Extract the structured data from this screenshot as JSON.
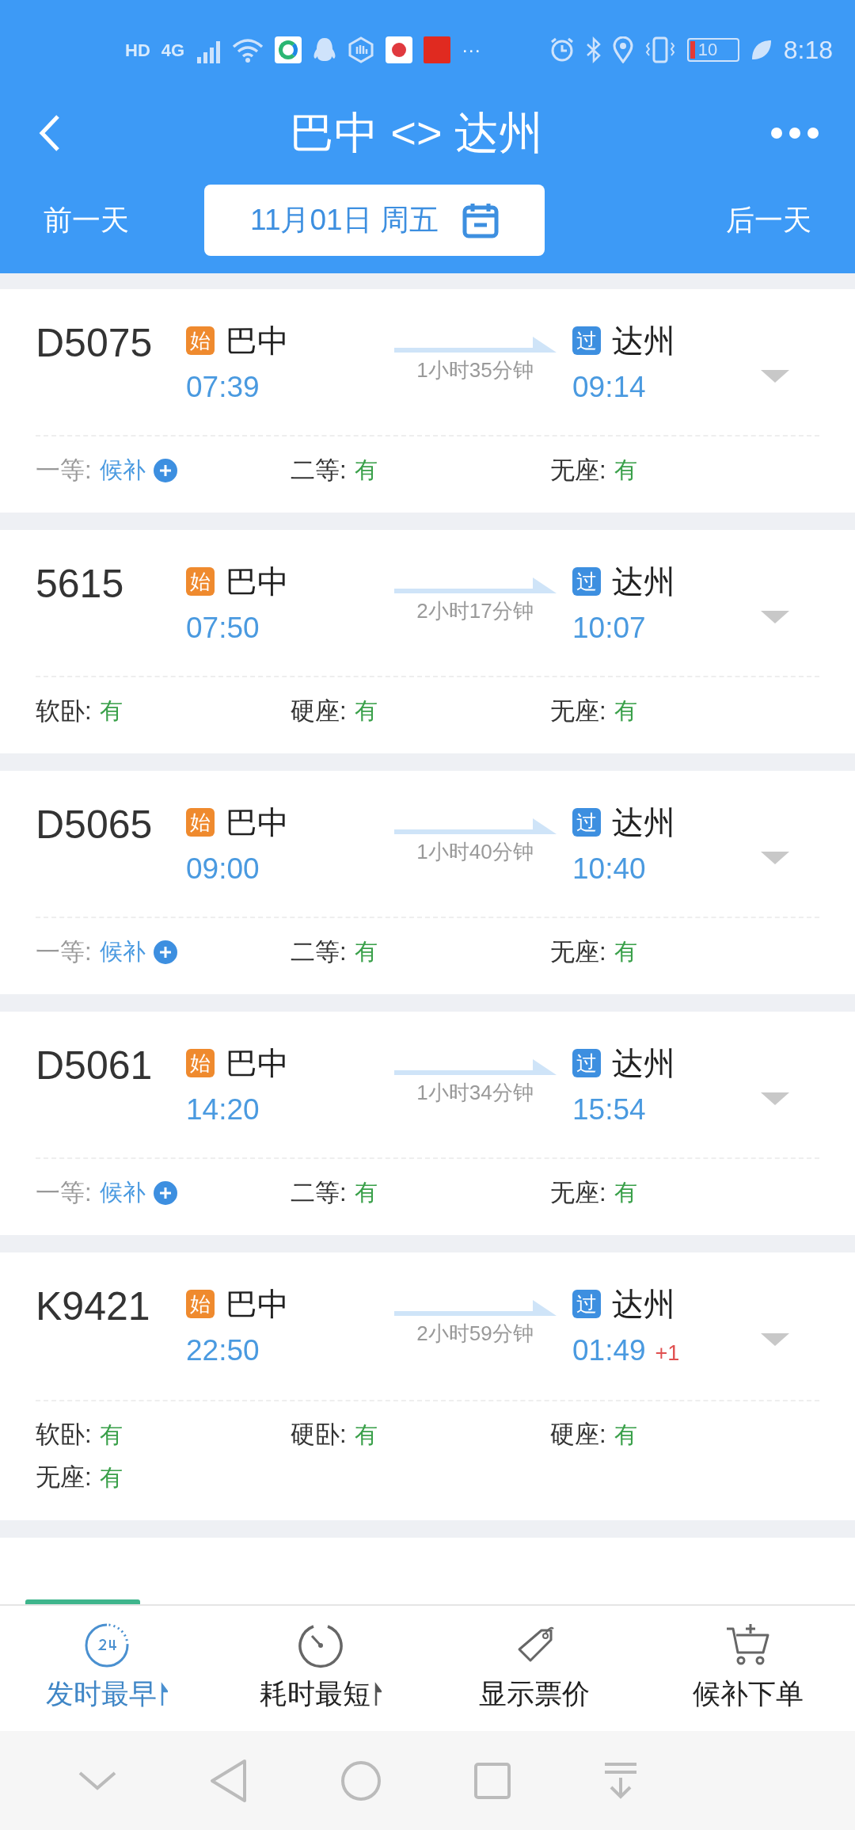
{
  "status_bar": {
    "left": [
      "HD",
      "4G"
    ],
    "more": "···",
    "battery": "10",
    "time": "8:18"
  },
  "header": {
    "title": "巴中 <> 达州",
    "prev_day": "前一天",
    "date": "11月01日 周五",
    "next_day": "后一天"
  },
  "trains": [
    {
      "number": "D5075",
      "from_tag": "始",
      "from": "巴中",
      "depart": "07:39",
      "duration": "1小时35分钟",
      "to_tag": "过",
      "to": "达州",
      "arrive": "09:14",
      "seats": [
        {
          "label": "一等:",
          "value": "候补",
          "kind": "waitlist"
        },
        {
          "label": "二等:",
          "value": "有",
          "kind": "available"
        },
        {
          "label": "无座:",
          "value": "有",
          "kind": "available"
        }
      ]
    },
    {
      "number": "5615",
      "from_tag": "始",
      "from": "巴中",
      "depart": "07:50",
      "duration": "2小时17分钟",
      "to_tag": "过",
      "to": "达州",
      "arrive": "10:07",
      "seats": [
        {
          "label": "软卧:",
          "value": "有",
          "kind": "available"
        },
        {
          "label": "硬座:",
          "value": "有",
          "kind": "available"
        },
        {
          "label": "无座:",
          "value": "有",
          "kind": "available"
        }
      ]
    },
    {
      "number": "D5065",
      "from_tag": "始",
      "from": "巴中",
      "depart": "09:00",
      "duration": "1小时40分钟",
      "to_tag": "过",
      "to": "达州",
      "arrive": "10:40",
      "seats": [
        {
          "label": "一等:",
          "value": "候补",
          "kind": "waitlist"
        },
        {
          "label": "二等:",
          "value": "有",
          "kind": "available"
        },
        {
          "label": "无座:",
          "value": "有",
          "kind": "available"
        }
      ]
    },
    {
      "number": "D5061",
      "from_tag": "始",
      "from": "巴中",
      "depart": "14:20",
      "duration": "1小时34分钟",
      "to_tag": "过",
      "to": "达州",
      "arrive": "15:54",
      "seats": [
        {
          "label": "一等:",
          "value": "候补",
          "kind": "waitlist"
        },
        {
          "label": "二等:",
          "value": "有",
          "kind": "available"
        },
        {
          "label": "无座:",
          "value": "有",
          "kind": "available"
        }
      ]
    },
    {
      "number": "K9421",
      "from_tag": "始",
      "from": "巴中",
      "depart": "22:50",
      "duration": "2小时59分钟",
      "to_tag": "过",
      "to": "达州",
      "arrive": "01:49",
      "day_offset": "+1",
      "seats": [
        {
          "label": "软卧:",
          "value": "有",
          "kind": "available"
        },
        {
          "label": "硬卧:",
          "value": "有",
          "kind": "available"
        },
        {
          "label": "硬座:",
          "value": "有",
          "kind": "available"
        },
        {
          "label": "无座:",
          "value": "有",
          "kind": "available"
        }
      ]
    }
  ],
  "toolbar": [
    {
      "label": "发时最早",
      "kind": "earliest",
      "selected": true,
      "sortable": true
    },
    {
      "label": "耗时最短",
      "kind": "shortest",
      "selected": false,
      "sortable": true
    },
    {
      "label": "显示票价",
      "kind": "price",
      "selected": false,
      "sortable": false
    },
    {
      "label": "候补下单",
      "kind": "waitlist",
      "selected": false,
      "sortable": false
    }
  ]
}
